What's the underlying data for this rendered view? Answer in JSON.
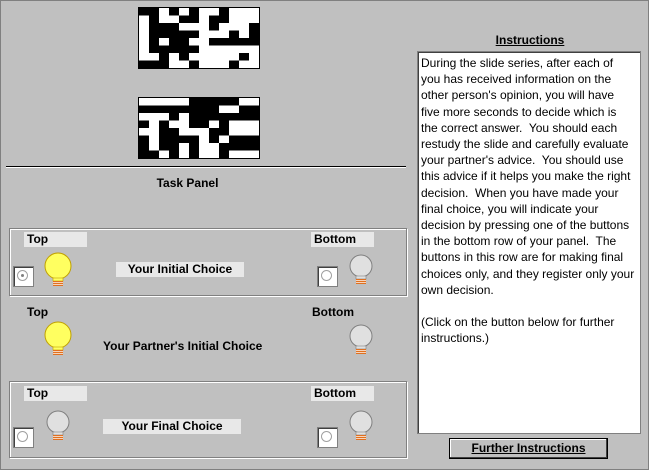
{
  "task_panel": {
    "title": "Task Panel",
    "row1": {
      "top_label": "Top",
      "bottom_label": "Bottom",
      "choice_label": "Your Initial Choice",
      "top_selected": true,
      "top_bulb": "lit",
      "bottom_bulb": "unlit"
    },
    "row2": {
      "top_label": "Top",
      "bottom_label": "Bottom",
      "choice_label": "Your Partner's Initial Choice",
      "top_bulb": "lit",
      "bottom_bulb": "unlit"
    },
    "row3": {
      "top_label": "Top",
      "bottom_label": "Bottom",
      "choice_label": "Your Final Choice",
      "top_bulb": "unlit",
      "bottom_bulb": "unlit"
    }
  },
  "instructions": {
    "title": "Instructions",
    "text": "During the slide series, after each of you has received information on the other person's opinion, you will have five more seconds to decide which is the correct answer.  You should each restudy the slide and carefully evaluate your partner's advice.  You should use this advice if it helps you make the right decision.  When you have made your final choice, you will indicate your decision by pressing one of the buttons in the bottom row of your panel.  The buttons in this row are for making final choices only, and they register only your own decision.\n\n(Click on the button below for further instructions.)",
    "button_label": "Further Instructions"
  },
  "colors": {
    "lit_bulb": "#ffff60",
    "unlit_bulb": "#e0e0e0",
    "background": "#c0c0c0"
  },
  "icons": [
    "pattern-slide",
    "lightbulb-icon",
    "radio-button"
  ]
}
